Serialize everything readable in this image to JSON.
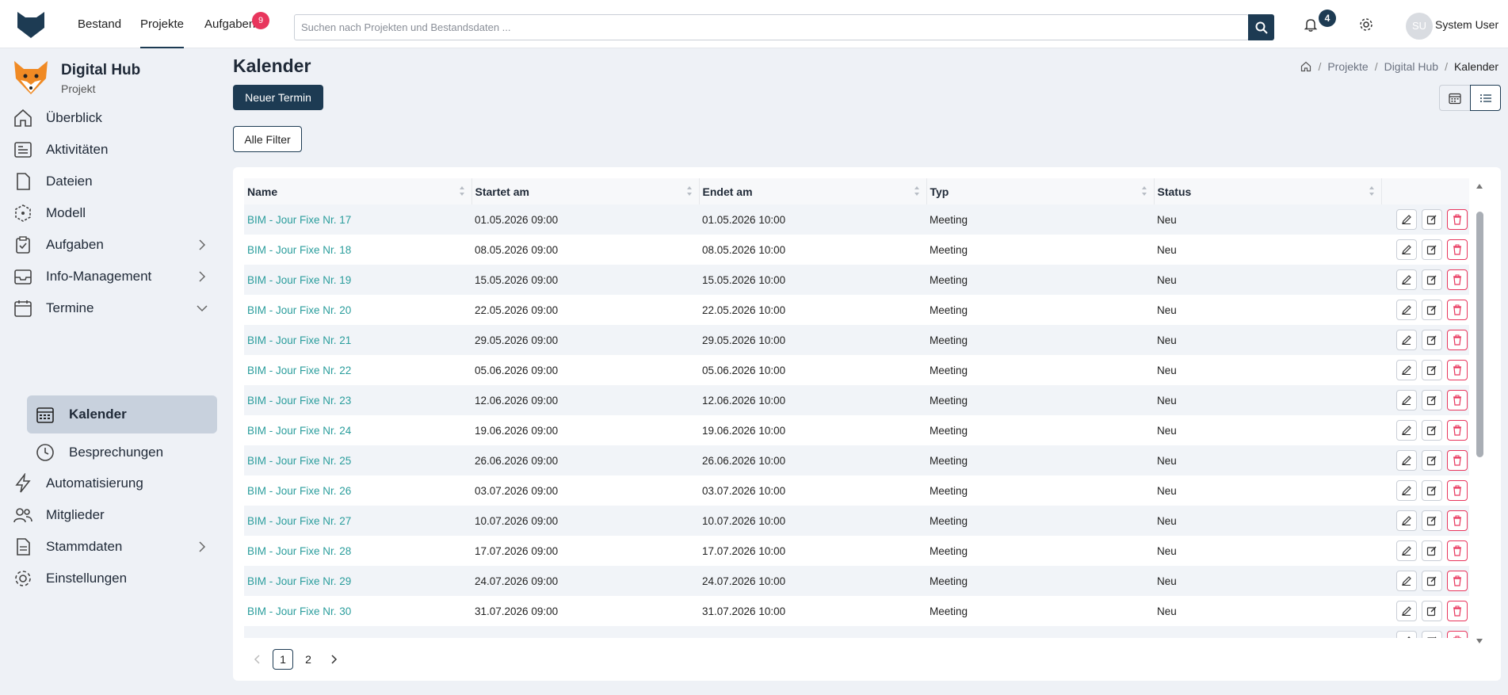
{
  "topbar": {
    "nav": [
      "Bestand",
      "Projekte",
      "Aufgaben"
    ],
    "tasks_badge": "9",
    "search_placeholder": "Suchen nach Projekten und Bestandsdaten ...",
    "notifications_badge": "4",
    "user_initials": "SU",
    "user_name": "System User"
  },
  "project": {
    "name": "Digital Hub",
    "subtitle": "Projekt"
  },
  "sidebar": {
    "items": [
      {
        "label": "Überblick",
        "icon": "home-icon"
      },
      {
        "label": "Aktivitäten",
        "icon": "activity-icon"
      },
      {
        "label": "Dateien",
        "icon": "file-icon"
      },
      {
        "label": "Modell",
        "icon": "cube-icon"
      },
      {
        "label": "Aufgaben",
        "icon": "clipboard-check-icon"
      },
      {
        "label": "Info-Management",
        "icon": "inbox-icon"
      },
      {
        "label": "Termine",
        "icon": "calendar-icon"
      },
      {
        "label": "Automatisierung",
        "icon": "lightning-icon"
      },
      {
        "label": "Mitglieder",
        "icon": "people-icon"
      },
      {
        "label": "Stammdaten",
        "icon": "document-icon"
      },
      {
        "label": "Einstellungen",
        "icon": "gear-icon"
      }
    ],
    "sub_items": [
      {
        "label": "Kalender",
        "icon": "calendar-grid-icon"
      },
      {
        "label": "Besprechungen",
        "icon": "clock-icon"
      }
    ]
  },
  "page": {
    "title": "Kalender",
    "new_button": "Neuer Termin",
    "filter_button": "Alle Filter"
  },
  "breadcrumb": [
    "Projekte",
    "Digital Hub",
    "Kalender"
  ],
  "table": {
    "columns": [
      "Name",
      "Startet am",
      "Endet am",
      "Typ",
      "Status"
    ],
    "rows": [
      [
        "BIM - Jour Fixe Nr. 17",
        "01.05.2026 09:00",
        "01.05.2026 10:00",
        "Meeting",
        "Neu"
      ],
      [
        "BIM - Jour Fixe Nr. 18",
        "08.05.2026 09:00",
        "08.05.2026 10:00",
        "Meeting",
        "Neu"
      ],
      [
        "BIM - Jour Fixe Nr. 19",
        "15.05.2026 09:00",
        "15.05.2026 10:00",
        "Meeting",
        "Neu"
      ],
      [
        "BIM - Jour Fixe Nr. 20",
        "22.05.2026 09:00",
        "22.05.2026 10:00",
        "Meeting",
        "Neu"
      ],
      [
        "BIM - Jour Fixe Nr. 21",
        "29.05.2026 09:00",
        "29.05.2026 10:00",
        "Meeting",
        "Neu"
      ],
      [
        "BIM - Jour Fixe Nr. 22",
        "05.06.2026 09:00",
        "05.06.2026 10:00",
        "Meeting",
        "Neu"
      ],
      [
        "BIM - Jour Fixe Nr. 23",
        "12.06.2026 09:00",
        "12.06.2026 10:00",
        "Meeting",
        "Neu"
      ],
      [
        "BIM - Jour Fixe Nr. 24",
        "19.06.2026 09:00",
        "19.06.2026 10:00",
        "Meeting",
        "Neu"
      ],
      [
        "BIM - Jour Fixe Nr. 25",
        "26.06.2026 09:00",
        "26.06.2026 10:00",
        "Meeting",
        "Neu"
      ],
      [
        "BIM - Jour Fixe Nr. 26",
        "03.07.2026 09:00",
        "03.07.2026 10:00",
        "Meeting",
        "Neu"
      ],
      [
        "BIM - Jour Fixe Nr. 27",
        "10.07.2026 09:00",
        "10.07.2026 10:00",
        "Meeting",
        "Neu"
      ],
      [
        "BIM - Jour Fixe Nr. 28",
        "17.07.2026 09:00",
        "17.07.2026 10:00",
        "Meeting",
        "Neu"
      ],
      [
        "BIM - Jour Fixe Nr. 29",
        "24.07.2026 09:00",
        "24.07.2026 10:00",
        "Meeting",
        "Neu"
      ],
      [
        "BIM - Jour Fixe Nr. 30",
        "31.07.2026 09:00",
        "31.07.2026 10:00",
        "Meeting",
        "Neu"
      ],
      [
        "",
        "",
        "",
        "",
        ""
      ]
    ]
  },
  "pagination": {
    "pages": [
      "1",
      "2"
    ],
    "current": "1"
  },
  "colors": {
    "primary": "#1d3b53",
    "link": "#2a9d9c",
    "danger": "#e8365d",
    "active_nav": "#c8d1dd"
  }
}
